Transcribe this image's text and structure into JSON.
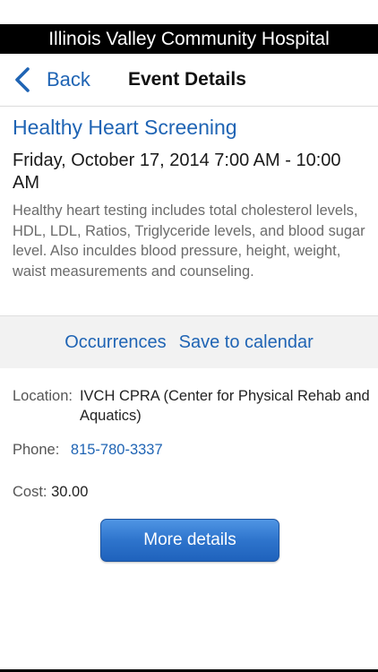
{
  "app": {
    "banner_title": "Illinois Valley Community Hospital"
  },
  "nav": {
    "back_label": "Back",
    "title": "Event Details"
  },
  "event": {
    "title": "Healthy Heart Screening",
    "date": "Friday, October 17, 2014 7:00 AM - 10:00 AM",
    "description": "Healthy heart testing includes total cholesterol levels, HDL, LDL, Ratios, Triglyceride levels, and blood sugar level. Also inculdes blood pressure, height, weight, waist measurements and counseling."
  },
  "actions": {
    "occurrences_label": "Occurrences",
    "save_label": "Save to calendar"
  },
  "info": {
    "location_label": "Location:",
    "location_value": "IVCH CPRA (Center for Physical Rehab and Aquatics)",
    "phone_label": "Phone:",
    "phone_value": "815-780-3337",
    "cost_label": "Cost:",
    "cost_value": "30.00"
  },
  "buttons": {
    "more_details": "More details"
  },
  "colors": {
    "accent": "#1f64b4",
    "banner_bg": "#000000",
    "actions_bg": "#f2f2f2"
  },
  "icons": {
    "back": "chevron-left-icon"
  }
}
